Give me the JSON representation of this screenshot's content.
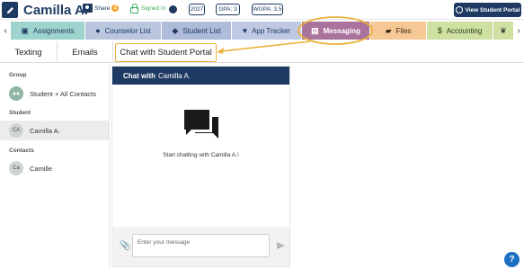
{
  "header": {
    "student_name": "Camilla A.",
    "share_label": "Share",
    "share_count": "2",
    "signed_in_label": "Signed in",
    "year": "2027",
    "gpa": "GPA: 3",
    "wgpa": "WGPA: 3.5",
    "view_portal_label": "View Student Portal"
  },
  "nav": {
    "prev_arrow": "‹",
    "next_arrow": "›",
    "tabs": [
      {
        "label": "Assignments",
        "icon": "clipboard-icon",
        "glyph": "▣"
      },
      {
        "label": "Counselor List",
        "icon": "person-icon",
        "glyph": "●"
      },
      {
        "label": "Student List",
        "icon": "graduation-cap-icon",
        "glyph": "◆"
      },
      {
        "label": "App Tracker",
        "icon": "heart-icon",
        "glyph": "♥"
      },
      {
        "label": "Messaging",
        "icon": "chat-icon",
        "glyph": "▤"
      },
      {
        "label": "Files",
        "icon": "folder-icon",
        "glyph": "▰"
      },
      {
        "label": "Accounting",
        "icon": "dollar-icon",
        "glyph": "$"
      }
    ]
  },
  "subtabs": {
    "texting": "Texting",
    "emails": "Emails",
    "portal_chat": "Chat with Student Portal"
  },
  "sidebar": {
    "group_label": "Group",
    "group_item": "Student + All Contacts",
    "student_label": "Student",
    "student_item": {
      "initials": "CA",
      "name": "Camilla A."
    },
    "contacts_label": "Contacts",
    "contact_item": {
      "initials": "Ca",
      "name": "Camille"
    }
  },
  "chat": {
    "header_prefix": "Chat with",
    "header_name": "Camilla A.",
    "empty_text": "Start chatting with Camilla A.!",
    "input_placeholder": "Enter your message"
  },
  "help": {
    "label": "?"
  },
  "colors": {
    "navy": "#1f3a62",
    "highlight": "#e9b13a",
    "messaging_tab": "#a9739b",
    "assignments_tab": "#9fd3cd",
    "counselor_tab": "#b9c6de",
    "student_tab": "#aebbd9",
    "tracker_tab": "#bfc9e3",
    "files_tab": "#f5c896",
    "accounting_tab": "#cfe0a3"
  }
}
